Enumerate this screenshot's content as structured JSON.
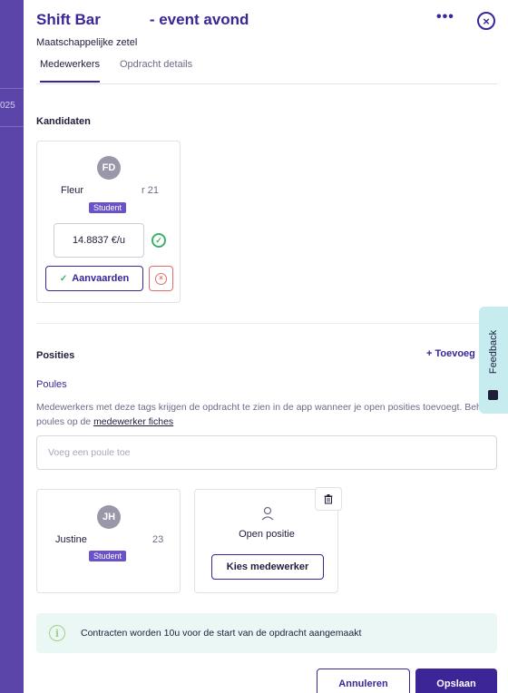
{
  "backdrop": {
    "year_fragment": "025"
  },
  "header": {
    "title_left": "Shift Bar",
    "title_right": "- event avond",
    "subtitle": "Maatschappelijke zetel",
    "more_label": "•••",
    "close_label": "×"
  },
  "tabs": [
    {
      "label": "Medewerkers",
      "active": true
    },
    {
      "label": "Opdracht details",
      "active": false
    }
  ],
  "candidates": {
    "heading": "Kandidaten",
    "card": {
      "initials": "FD",
      "name": "Fleur",
      "age": "r 21",
      "tag": "Student",
      "rate": "14.8837  €/u",
      "accept_label": "Aanvaarden",
      "accept_tick": "✓"
    }
  },
  "positions": {
    "heading": "Posities",
    "add_label": "+ Toevoeg",
    "poules_heading": "Poules",
    "poules_desc": "Medewerkers met deze tags krijgen de opdracht te zien in de app wanneer je open posities toevoegt. Beheer poules op de ",
    "poules_link": "medewerker fiches",
    "poule_placeholder": "Voeg een poule toe",
    "filled": {
      "initials": "JH",
      "name": "Justine",
      "age": "23",
      "tag": "Student"
    },
    "open": {
      "label": "Open positie",
      "choose_label": "Kies medewerker"
    }
  },
  "info": {
    "text": "Contracten worden 10u voor de start van de opdracht aangemaakt",
    "icon_glyph": "i"
  },
  "footer": {
    "cancel_label": "Annuleren",
    "save_label": "Opslaan"
  },
  "feedback": {
    "label": "Feedback"
  },
  "colors": {
    "brand": "#3b2597",
    "success": "#3ab26a",
    "danger": "#e46b6b",
    "tag": "#6b52c9",
    "info_bg": "#eaf7f5"
  }
}
